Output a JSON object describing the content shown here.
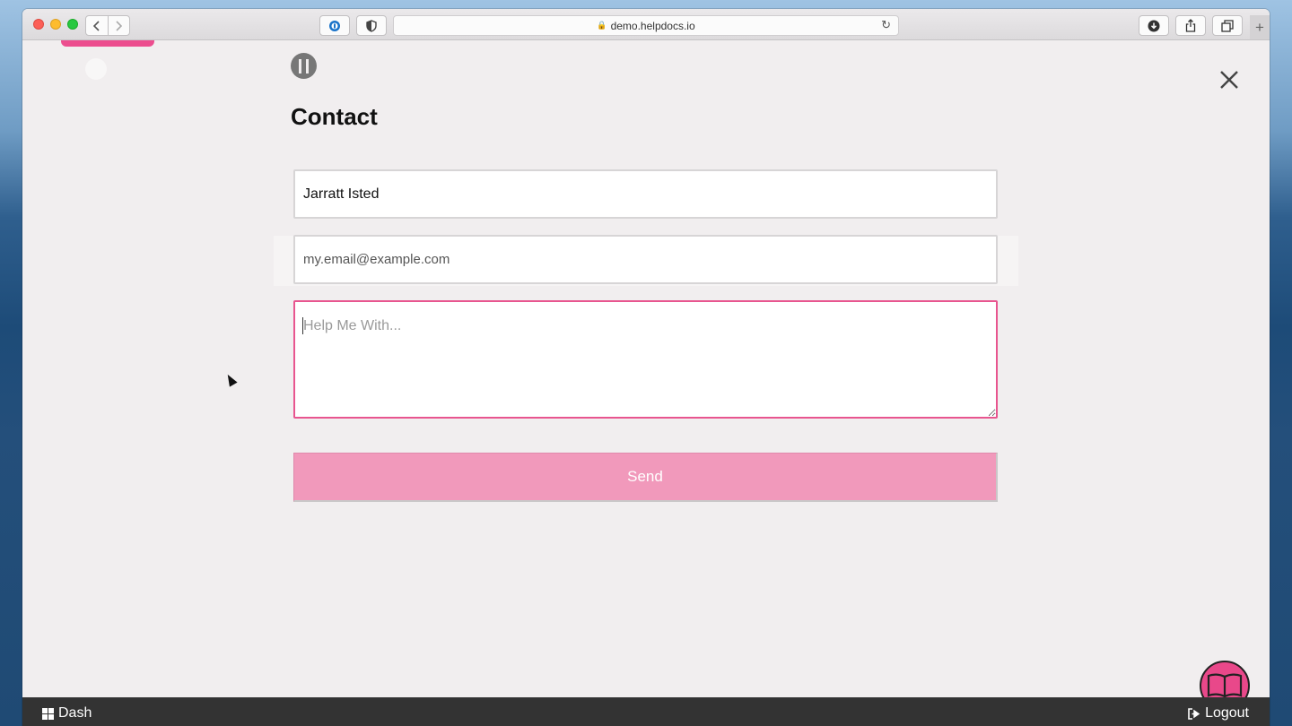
{
  "browser": {
    "url": "demo.helpdocs.io"
  },
  "page": {
    "title": "Contact"
  },
  "form": {
    "name_value": "Jarratt Isted",
    "email_placeholder": "my.email@example.com",
    "message_placeholder": "Help Me With...",
    "send_label": "Send"
  },
  "footer": {
    "dash_label": "Dash",
    "logout_label": "Logout"
  },
  "colors": {
    "accent": "#e9488a",
    "send_button": "#f199bb"
  },
  "icons": {
    "logo": "helpdocs-logo-icon",
    "close": "close-icon",
    "help_widget": "open-book-icon",
    "dash": "grid-icon",
    "logout": "logout-icon"
  }
}
